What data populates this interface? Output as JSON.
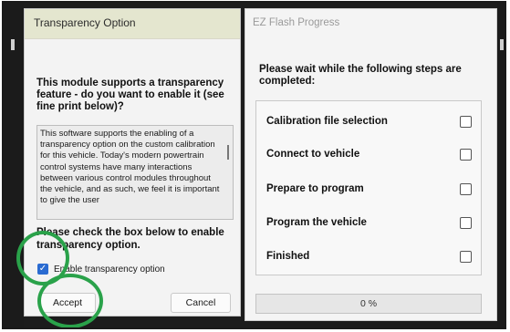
{
  "transparency_dialog": {
    "title": "Transparency Option",
    "question": "This module supports a transparency feature - do you want to enable it (see fine print below)?",
    "fine_print": "This software supports the enabling of a transparency option on the custom calibration for this vehicle.  Today's modern powertrain control systems have many interactions between various control modules throughout the vehicle, and as such, we feel it is important to give the user",
    "check_prompt": "Please check the box below to enable transparency option.",
    "checkbox_label": "Enable transparency option",
    "checkbox_checked": true,
    "accept_label": "Accept",
    "cancel_label": "Cancel",
    "highlight_color": "#2aa24a",
    "checkbox_color": "#2a6bd1"
  },
  "progress_dialog": {
    "title": "EZ Flash Progress",
    "wait_message": "Please wait while the following steps are completed:",
    "steps": [
      {
        "label": "Calibration file selection",
        "checked": false
      },
      {
        "label": "Connect to vehicle",
        "checked": false
      },
      {
        "label": "Prepare to program",
        "checked": false
      },
      {
        "label": "Program the vehicle",
        "checked": false
      },
      {
        "label": "Finished",
        "checked": false
      }
    ],
    "progress_percent": 0,
    "progress_text": "0 %"
  }
}
